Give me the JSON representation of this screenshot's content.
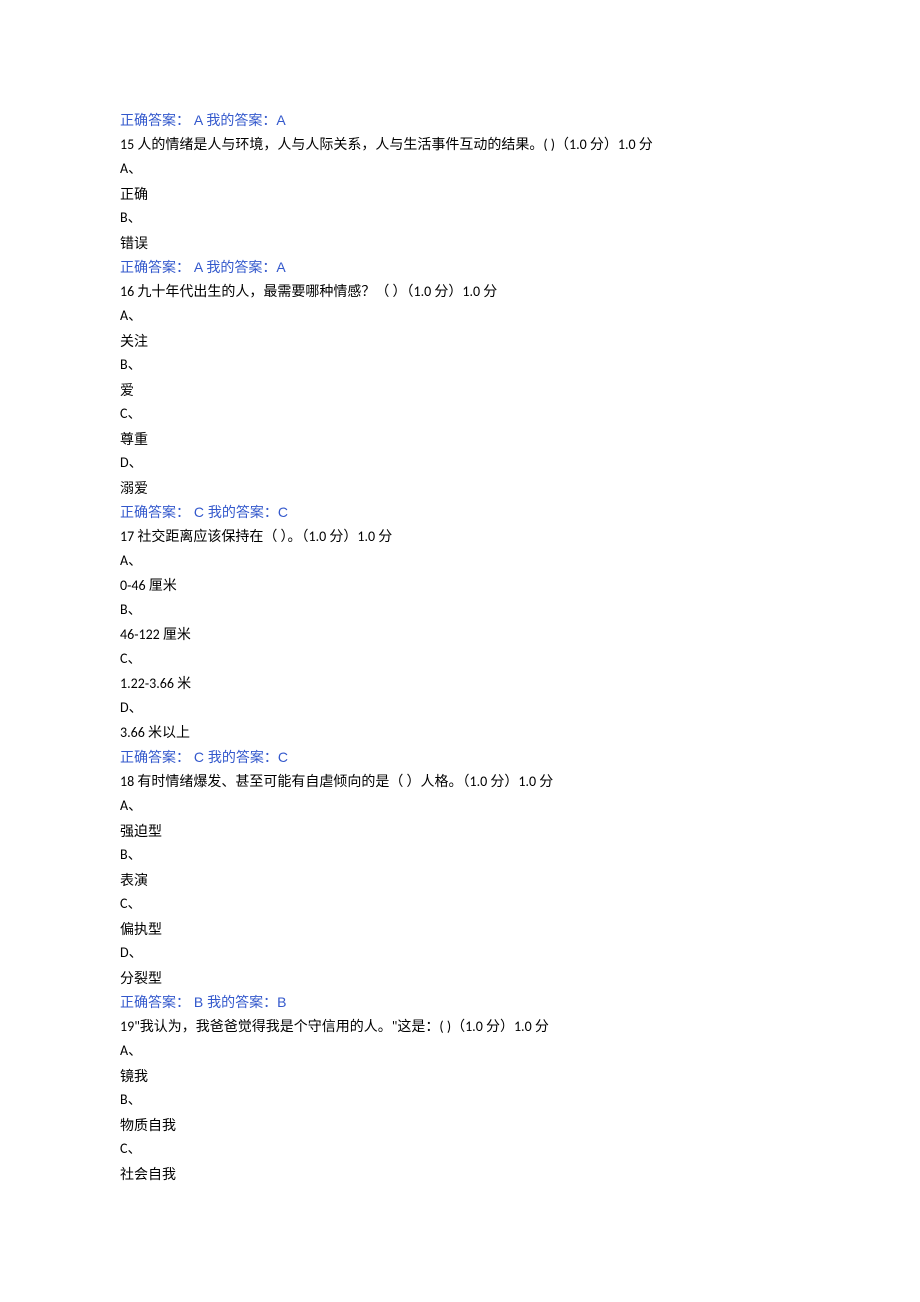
{
  "lines": [
    {
      "type": "answer",
      "text": "正确答案： A 我的答案：A"
    },
    {
      "type": "q",
      "text": "15 人的情绪是人与环境，人与人际关系，人与生活事件互动的结果。( )（1.0 分）1.0 分"
    },
    {
      "type": "opt_letter",
      "text": "A、"
    },
    {
      "type": "opt_text",
      "text": "正确"
    },
    {
      "type": "opt_letter",
      "text": "B、"
    },
    {
      "type": "opt_text",
      "text": "错误"
    },
    {
      "type": "answer",
      "text": "正确答案： A 我的答案：A"
    },
    {
      "type": "q",
      "text": "16 九十年代出生的人，最需要哪种情感？（ ）（1.0 分）1.0 分"
    },
    {
      "type": "opt_letter",
      "text": "A、"
    },
    {
      "type": "opt_text",
      "text": "关注"
    },
    {
      "type": "opt_letter",
      "text": "B、"
    },
    {
      "type": "opt_text",
      "text": "爱"
    },
    {
      "type": "opt_letter",
      "text": "C、"
    },
    {
      "type": "opt_text",
      "text": "尊重"
    },
    {
      "type": "opt_letter",
      "text": "D、"
    },
    {
      "type": "opt_text",
      "text": "溺爱"
    },
    {
      "type": "answer",
      "text": "正确答案： C 我的答案：C"
    },
    {
      "type": "q",
      "text": "17 社交距离应该保持在（ ）。（1.0 分）1.0 分"
    },
    {
      "type": "opt_letter",
      "text": "A、"
    },
    {
      "type": "opt_text_num",
      "text": "0-46 厘米"
    },
    {
      "type": "opt_letter",
      "text": "B、"
    },
    {
      "type": "opt_text_num",
      "text": "46-122 厘米"
    },
    {
      "type": "opt_letter",
      "text": "C、"
    },
    {
      "type": "opt_text_num",
      "text": "1.22-3.66 米"
    },
    {
      "type": "opt_letter",
      "text": "D、"
    },
    {
      "type": "opt_text_num",
      "text": "3.66 米以上"
    },
    {
      "type": "answer",
      "text": "正确答案： C 我的答案：C"
    },
    {
      "type": "q",
      "text": "18 有时情绪爆发、甚至可能有自虐倾向的是（ ）人格。（1.0 分）1.0 分"
    },
    {
      "type": "opt_letter",
      "text": "A、"
    },
    {
      "type": "opt_text",
      "text": "强迫型"
    },
    {
      "type": "opt_letter",
      "text": "B、"
    },
    {
      "type": "opt_text",
      "text": "表演"
    },
    {
      "type": "opt_letter",
      "text": "C、"
    },
    {
      "type": "opt_text",
      "text": "偏执型"
    },
    {
      "type": "opt_letter",
      "text": "D、"
    },
    {
      "type": "opt_text",
      "text": "分裂型"
    },
    {
      "type": "answer",
      "text": "正确答案： B 我的答案：B"
    },
    {
      "type": "q",
      "text": "19\"我认为，我爸爸觉得我是个守信用的人。\"这是：( )（1.0 分）1.0 分"
    },
    {
      "type": "opt_letter",
      "text": "A、"
    },
    {
      "type": "opt_text",
      "text": "镜我"
    },
    {
      "type": "opt_letter",
      "text": "B、"
    },
    {
      "type": "opt_text",
      "text": "物质自我"
    },
    {
      "type": "opt_letter",
      "text": "C、"
    },
    {
      "type": "opt_text",
      "text": "社会自我"
    }
  ]
}
